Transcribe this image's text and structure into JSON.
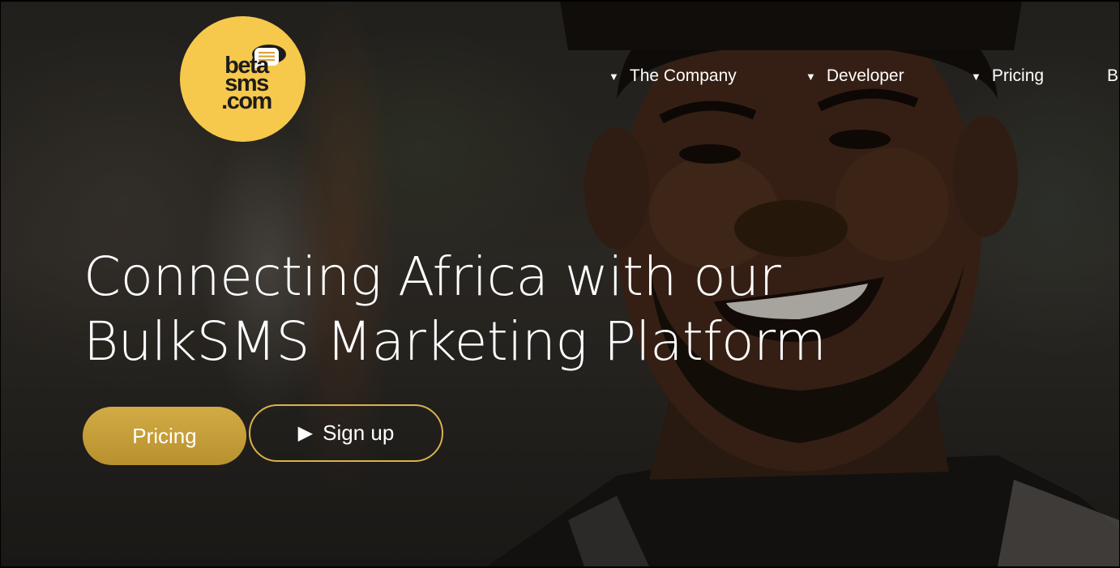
{
  "logo": {
    "line1": "beta",
    "line2": "sms",
    "line3": ".com"
  },
  "nav": {
    "items": [
      {
        "label": "The Company",
        "has_dropdown": true
      },
      {
        "label": "Developer",
        "has_dropdown": true
      },
      {
        "label": "Pricing",
        "has_dropdown": true
      },
      {
        "label": "B",
        "has_dropdown": false
      }
    ],
    "caret_icon": "caret-down-icon"
  },
  "hero": {
    "headline_line1": "Connecting Africa with our",
    "headline_line2": "BulkSMS Marketing Platform",
    "pricing_button": "Pricing",
    "signup_button": "Sign up",
    "signup_icon": "play-icon"
  },
  "colors": {
    "brand_yellow": "#f6c84c",
    "button_gold": "#c9a23d",
    "border_gold": "#d9b24a",
    "text": "#ffffff"
  }
}
